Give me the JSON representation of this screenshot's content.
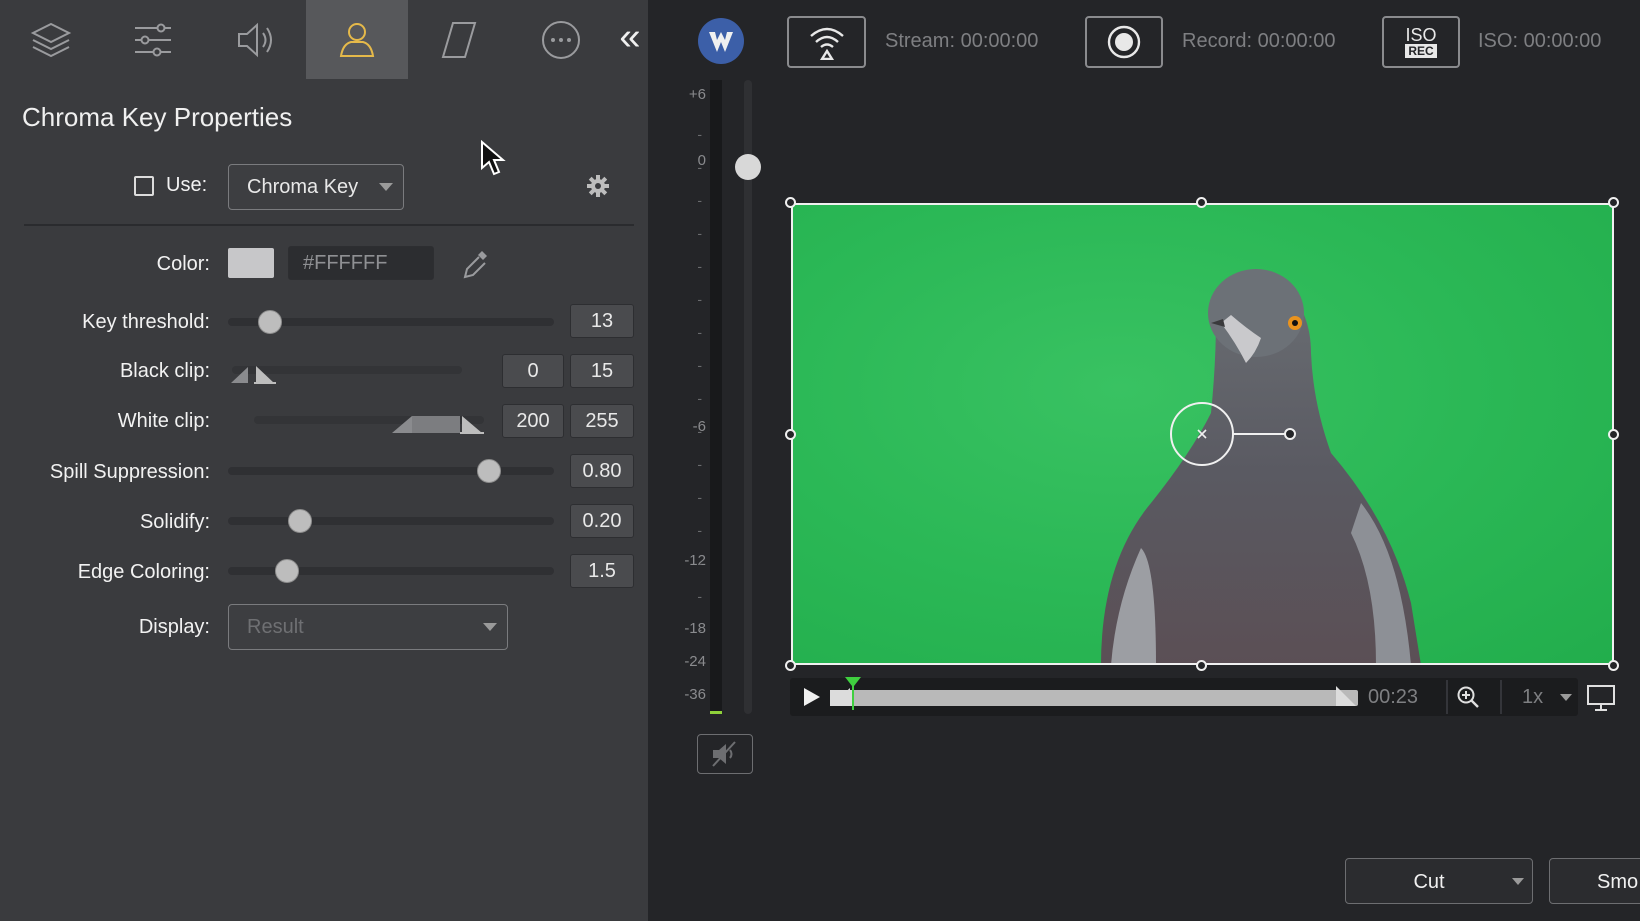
{
  "panel": {
    "title": "Chroma Key Properties",
    "use": {
      "label": "Use:",
      "checked": false,
      "mode": "Chroma Key"
    },
    "color": {
      "label": "Color:",
      "hex": "#FFFFFF",
      "swatch": "#c7c7c9"
    },
    "key_threshold": {
      "label": "Key threshold:",
      "value": "13",
      "level": 0.13
    },
    "black_clip": {
      "label": "Black clip:",
      "low": "0",
      "high": "15"
    },
    "white_clip": {
      "label": "White clip:",
      "low": "200",
      "high": "255"
    },
    "spill_suppression": {
      "label": "Spill Suppression:",
      "value": "0.80",
      "level": 0.8
    },
    "solidify": {
      "label": "Solidify:",
      "value": "0.20",
      "level": 0.22
    },
    "edge_coloring": {
      "label": "Edge Coloring:",
      "value": "1.5",
      "level": 0.18
    },
    "display": {
      "label": "Display:",
      "value": "Result"
    }
  },
  "tabs": [
    {
      "name": "layers",
      "icon": "layers-icon",
      "active": false
    },
    {
      "name": "adjustments",
      "icon": "sliders-icon",
      "active": false
    },
    {
      "name": "audio",
      "icon": "speaker-icon",
      "active": false
    },
    {
      "name": "chroma-key",
      "icon": "person-icon",
      "active": true
    },
    {
      "name": "mask",
      "icon": "parallelogram-icon",
      "active": false
    },
    {
      "name": "more",
      "icon": "more-icon",
      "active": false
    }
  ],
  "meter": {
    "labels": [
      "+6",
      "0",
      "-6",
      "-12",
      "-18",
      "-24",
      "-36"
    ]
  },
  "topbar": {
    "stream": "Stream:  00:00:00",
    "record": "Record:  00:00:00",
    "iso_badge_top": "ISO",
    "iso_badge_bottom": "REC",
    "iso": "ISO:  00:00:00"
  },
  "transport": {
    "time": "00:23",
    "speed": "1x"
  },
  "bottom": {
    "transition": "Cut",
    "smooth": "Smo"
  },
  "colors": {
    "accent": "#e5b94a",
    "green_screen": "#2bb856",
    "playhead": "#3fcf3f"
  }
}
